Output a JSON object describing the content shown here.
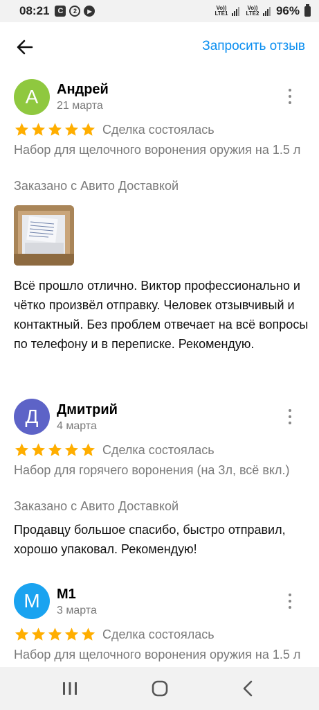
{
  "status_bar": {
    "time": "08:21",
    "notif_icons": [
      "C",
      "2",
      "▶"
    ],
    "sim1_label": "Vo)) LTE1",
    "sim2_label": "Vo)) LTE2",
    "battery": "96%"
  },
  "header": {
    "back_icon": "arrow-left-icon",
    "request_review": "Запросить отзыв"
  },
  "colors": {
    "accent": "#0a8ef0",
    "star": "#ffae00"
  },
  "reviews": [
    {
      "avatar_letter": "А",
      "avatar_color": "#8fc83f",
      "name": "Андрей",
      "date": "21 марта",
      "rating": 5,
      "deal_status": "Сделка состоялась",
      "product": "Набор для щелочного воронения оружия на 1.5 л",
      "delivery": "Заказано с Авито Доставкой",
      "text": "Всё прошло отлично. Виктор профессионально и чётко произвёл отправку. Человек отзывчивый и контактный. Без проблем отвечает на всё вопросы по телефону и в переписке. Рекомендую."
    },
    {
      "avatar_letter": "Д",
      "avatar_color": "#5d63c7",
      "name": "Дмитрий",
      "date": "4 марта",
      "rating": 5,
      "deal_status": "Сделка состоялась",
      "product": "Набор для горячего воронения (на 3л, всё вкл.)",
      "delivery": "Заказано с Авито Доставкой",
      "text": "Продавцу большое спасибо, быстро отправил, хорошо упаковал. Рекомендую!"
    },
    {
      "avatar_letter": "М",
      "avatar_color": "#1aa3f0",
      "name": "М1",
      "date": "3 марта",
      "rating": 5,
      "deal_status": "Сделка состоялась",
      "product": "Набор для щелочного воронения оружия на 1.5 л"
    }
  ],
  "nav_bar": {
    "recents_icon": "recents-icon",
    "home_icon": "home-icon",
    "back_icon": "back-chevron-icon"
  }
}
